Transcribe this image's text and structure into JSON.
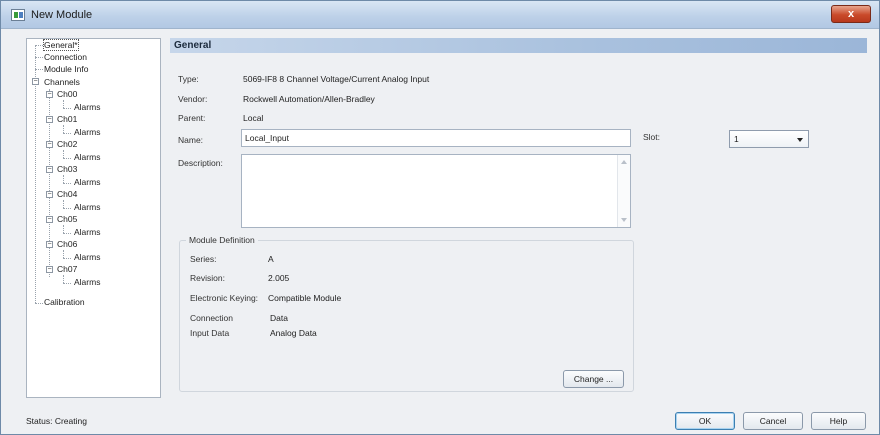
{
  "window": {
    "title": "New Module",
    "close_glyph": "x"
  },
  "tree": {
    "general": "General*",
    "connection": "Connection",
    "module_info": "Module Info",
    "channels": "Channels",
    "channel_items": [
      {
        "name": "Ch00",
        "child": "Alarms"
      },
      {
        "name": "Ch01",
        "child": "Alarms"
      },
      {
        "name": "Ch02",
        "child": "Alarms"
      },
      {
        "name": "Ch03",
        "child": "Alarms"
      },
      {
        "name": "Ch04",
        "child": "Alarms"
      },
      {
        "name": "Ch05",
        "child": "Alarms"
      },
      {
        "name": "Ch06",
        "child": "Alarms"
      },
      {
        "name": "Ch07",
        "child": "Alarms"
      }
    ],
    "calibration": "Calibration",
    "expander_glyph": "−"
  },
  "general": {
    "header": "General",
    "type_label": "Type:",
    "type_value": "5069-IF8 8 Channel Voltage/Current Analog Input",
    "vendor_label": "Vendor:",
    "vendor_value": "Rockwell Automation/Allen-Bradley",
    "parent_label": "Parent:",
    "parent_value": "Local",
    "name_label": "Name:",
    "name_value": "Local_Input",
    "slot_label": "Slot:",
    "slot_value": "1",
    "description_label": "Description:",
    "description_value": ""
  },
  "module_definition": {
    "title": "Module Definition",
    "series_label": "Series:",
    "series_value": "A",
    "revision_label": "Revision:",
    "revision_value": "2.005",
    "keying_label": "Electronic Keying:",
    "keying_value": "Compatible Module",
    "connection_label": "Connection",
    "connection_value": "Data",
    "input_data_label": "Input Data",
    "input_data_value": "Analog Data",
    "change_button": "Change ..."
  },
  "footer": {
    "status": "Status:  Creating",
    "ok": "OK",
    "cancel": "Cancel",
    "help": "Help"
  },
  "colors": {
    "header_blue": "#a9c1de",
    "close_red": "#c94a2a"
  }
}
